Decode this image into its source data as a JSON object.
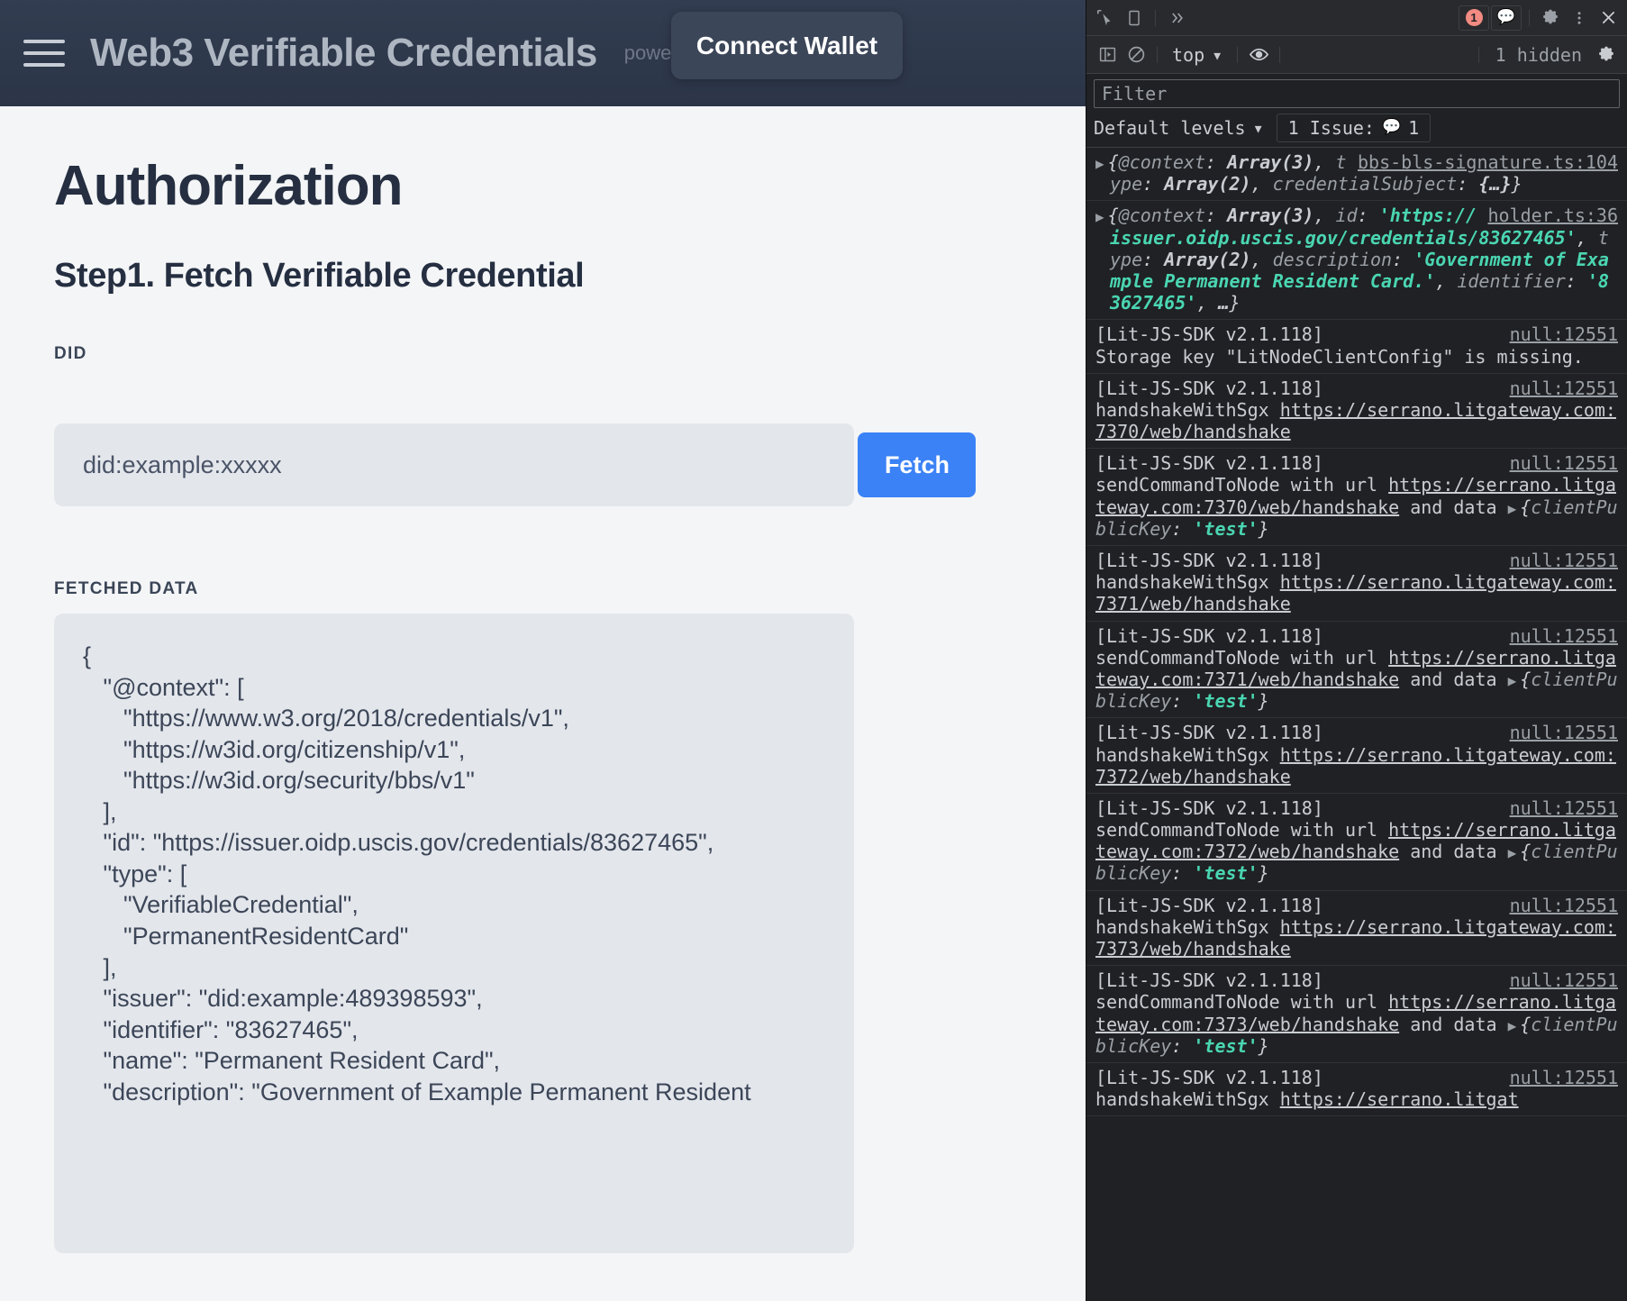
{
  "app": {
    "header": {
      "menu_icon": "hamburger-icon",
      "title": "Web3 Verifiable Credentials",
      "powered_by": "powe",
      "connect_wallet_label": "Connect Wallet"
    },
    "page_title": "Authorization",
    "step_title": "Step1. Fetch Verifiable Credential",
    "did": {
      "label": "DID",
      "placeholder": "did:example:xxxxx",
      "value": ""
    },
    "fetch_button_label": "Fetch",
    "fetched": {
      "label": "FETCHED DATA",
      "json": "{\n   \"@context\": [\n      \"https://www.w3.org/2018/credentials/v1\",\n      \"https://w3id.org/citizenship/v1\",\n      \"https://w3id.org/security/bbs/v1\"\n   ],\n   \"id\": \"https://issuer.oidp.uscis.gov/credentials/83627465\",\n   \"type\": [\n      \"VerifiableCredential\",\n      \"PermanentResidentCard\"\n   ],\n   \"issuer\": \"did:example:489398593\",\n   \"identifier\": \"83627465\",\n   \"name\": \"Permanent Resident Card\",\n   \"description\": \"Government of Example Permanent Resident"
    },
    "colors": {
      "header_bg": "#2f3a4d",
      "accent_blue": "#3b82f6",
      "page_bg": "#f4f5f7",
      "field_bg": "#e3e6eb",
      "heading": "#252f41"
    }
  },
  "devtools": {
    "toolbar": {
      "inspect_icon": "inspect-cursor-icon",
      "device_icon": "device-toolbar-icon",
      "more_panels_icon": "chevron-double-right-icon",
      "error_count": "1",
      "message_count": "1",
      "settings_icon": "gear-icon",
      "kebab_icon": "more-vertical-icon",
      "close_icon": "close-icon"
    },
    "console_bar": {
      "sidebar_icon": "console-sidebar-icon",
      "clear_icon": "clear-console-icon",
      "context": "top",
      "eye_icon": "live-expression-icon",
      "hidden_label": "1 hidden",
      "settings_icon": "gear-icon"
    },
    "filter": {
      "placeholder": "Filter",
      "value": ""
    },
    "levels": {
      "label": "Default levels",
      "issue_label": "1 Issue:",
      "issue_count": "1"
    },
    "logs": [
      {
        "source": "bbs-bls-signature.ts:104",
        "kind": "object",
        "expandable": true,
        "parts": [
          {
            "t": "punc",
            "v": "{"
          },
          {
            "t": "key",
            "v": "@context"
          },
          {
            "t": "punc",
            "v": ": "
          },
          {
            "t": "val",
            "v": "Array(3)"
          },
          {
            "t": "punc",
            "v": ", "
          },
          {
            "t": "key",
            "v": "type"
          },
          {
            "t": "punc",
            "v": ": "
          },
          {
            "t": "val",
            "v": "Array(2)"
          },
          {
            "t": "punc",
            "v": ", "
          },
          {
            "t": "key",
            "v": "credentialSubject"
          },
          {
            "t": "punc",
            "v": ": "
          },
          {
            "t": "val",
            "v": "{…}"
          },
          {
            "t": "punc",
            "v": "}"
          }
        ]
      },
      {
        "source": "holder.ts:36",
        "kind": "object",
        "expandable": true,
        "parts": [
          {
            "t": "punc",
            "v": "{"
          },
          {
            "t": "key",
            "v": "@context"
          },
          {
            "t": "punc",
            "v": ": "
          },
          {
            "t": "val",
            "v": "Array(3)"
          },
          {
            "t": "punc",
            "v": ", "
          },
          {
            "t": "key",
            "v": "id"
          },
          {
            "t": "punc",
            "v": ": "
          },
          {
            "t": "str",
            "v": "'https://issuer.oidp.uscis.gov/credentials/83627465'"
          },
          {
            "t": "punc",
            "v": ", "
          },
          {
            "t": "key",
            "v": "type"
          },
          {
            "t": "punc",
            "v": ": "
          },
          {
            "t": "val",
            "v": "Array(2)"
          },
          {
            "t": "punc",
            "v": ", "
          },
          {
            "t": "key",
            "v": "description"
          },
          {
            "t": "punc",
            "v": ": "
          },
          {
            "t": "str",
            "v": "'Government of Example Permanent Resident Card.'"
          },
          {
            "t": "punc",
            "v": ", "
          },
          {
            "t": "key",
            "v": "identifier"
          },
          {
            "t": "punc",
            "v": ": "
          },
          {
            "t": "str",
            "v": "'83627465'"
          },
          {
            "t": "punc",
            "v": ", "
          },
          {
            "t": "val",
            "v": "…"
          },
          {
            "t": "punc",
            "v": "}"
          }
        ]
      },
      {
        "source": "null:12551",
        "kind": "text",
        "prefix": "[Lit-JS-SDK v2.1.118]",
        "text": "Storage key \"LitNodeClientConfig\" is missing."
      },
      {
        "source": "null:12551",
        "kind": "link",
        "prefix": "[Lit-JS-SDK v2.1.118]",
        "pre_text": "handshakeWithSgx ",
        "url": "https://serrano.litgateway.com:7370/web/handshake"
      },
      {
        "source": "null:12551",
        "kind": "link-data",
        "prefix": "[Lit-JS-SDK v2.1.118]",
        "pre_text": "sendCommandToNode with url ",
        "url": "https://serrano.litgateway.com:7370/web/handshake",
        "post_text": " and data ",
        "data_key": "clientPublicKey",
        "data_value": "'test'"
      },
      {
        "source": "null:12551",
        "kind": "link",
        "prefix": "[Lit-JS-SDK v2.1.118]",
        "pre_text": "handshakeWithSgx ",
        "url": "https://serrano.litgateway.com:7371/web/handshake"
      },
      {
        "source": "null:12551",
        "kind": "link-data",
        "prefix": "[Lit-JS-SDK v2.1.118]",
        "pre_text": "sendCommandToNode with url ",
        "url": "https://serrano.litgateway.com:7371/web/handshake",
        "post_text": " and data ",
        "data_key": "clientPublicKey",
        "data_value": "'test'"
      },
      {
        "source": "null:12551",
        "kind": "link",
        "prefix": "[Lit-JS-SDK v2.1.118]",
        "pre_text": "handshakeWithSgx ",
        "url": "https://serrano.litgateway.com:7372/web/handshake"
      },
      {
        "source": "null:12551",
        "kind": "link-data",
        "prefix": "[Lit-JS-SDK v2.1.118]",
        "pre_text": "sendCommandToNode with url ",
        "url": "https://serrano.litgateway.com:7372/web/handshake",
        "post_text": " and data ",
        "data_key": "clientPublicKey",
        "data_value": "'test'"
      },
      {
        "source": "null:12551",
        "kind": "link",
        "prefix": "[Lit-JS-SDK v2.1.118]",
        "pre_text": "handshakeWithSgx ",
        "url": "https://serrano.litgateway.com:7373/web/handshake"
      },
      {
        "source": "null:12551",
        "kind": "link-data",
        "prefix": "[Lit-JS-SDK v2.1.118]",
        "pre_text": "sendCommandToNode with url ",
        "url": "https://serrano.litgateway.com:7373/web/handshake",
        "post_text": " and data ",
        "data_key": "clientPublicKey",
        "data_value": "'test'"
      },
      {
        "source": "null:12551",
        "kind": "link",
        "prefix": "[Lit-JS-SDK v2.1.118]",
        "pre_text": "handshakeWithSgx ",
        "url": "https://serrano.litgat"
      }
    ]
  }
}
